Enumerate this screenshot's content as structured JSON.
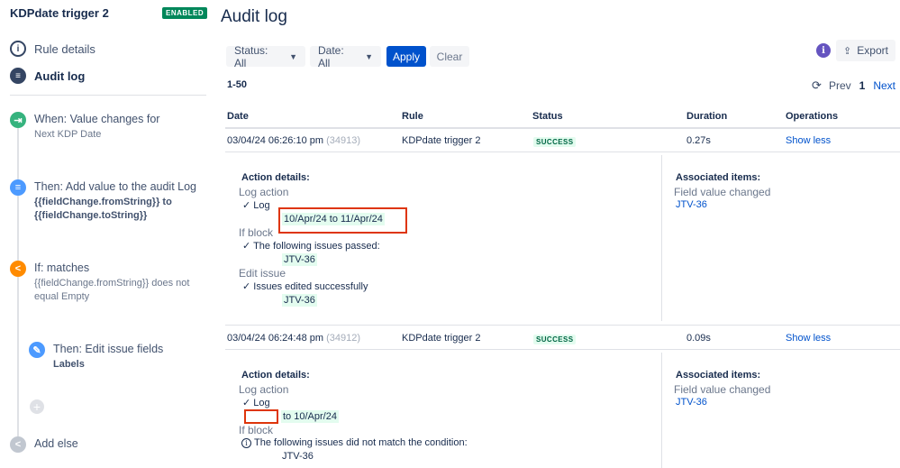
{
  "sidebar": {
    "rule_title": "KDPdate trigger 2",
    "enabled_badge": "ENABLED",
    "nav": [
      {
        "label": "Rule details",
        "icon": "info-icon"
      },
      {
        "label": "Audit log",
        "icon": "list-icon",
        "active": true
      }
    ],
    "steps": [
      {
        "title": "When: Value changes for",
        "sub": "Next KDP Date",
        "icon": "trigger-icon",
        "color": "#36b37e"
      },
      {
        "title": "Then: Add value to the audit Log",
        "sub1": "{{fieldChange.fromString}} to",
        "sub2": "{{fieldChange.toString}}",
        "icon": "document-icon",
        "color": "#4c9aff"
      },
      {
        "title": "If: matches",
        "sub1": "{{fieldChange.fromString}} does not",
        "sub2": "equal Empty",
        "icon": "branch-icon",
        "color": "#ff8b00"
      },
      {
        "title": "Then: Edit issue fields",
        "sub": "Labels",
        "icon": "pencil-icon",
        "color": "#4c9aff"
      },
      {
        "title": "Add else",
        "icon": "branch-icon",
        "color": "#c1c7d0"
      }
    ]
  },
  "main": {
    "title": "Audit log",
    "filters": {
      "status": "Status: All",
      "date": "Date: All",
      "apply": "Apply",
      "clear": "Clear"
    },
    "export": "Export",
    "range": "1-50",
    "pager": {
      "prev": "Prev",
      "current": "1",
      "next": "Next"
    },
    "columns": [
      "Date",
      "Rule",
      "Status",
      "Duration",
      "Operations"
    ],
    "rows": [
      {
        "date": "03/04/24 06:26:10 pm",
        "id": "(34913)",
        "rule": "KDPdate trigger 2",
        "status": "SUCCESS",
        "duration": "0.27s",
        "operation": "Show less",
        "details": {
          "heading": "Action details:",
          "log_section": "Log action",
          "log_label": "✓ Log",
          "log_value": "10/Apr/24 to 11/Apr/24",
          "if_section": "If block",
          "if_line": "✓ The following issues passed:",
          "if_issue": "JTV-36",
          "edit_section": "Edit issue",
          "edit_line": "✓ Issues edited successfully",
          "edit_issue": "JTV-36",
          "assoc_heading": "Associated items:",
          "assoc_label": "Field value changed",
          "assoc_issue": "JTV-36"
        }
      },
      {
        "date": "03/04/24 06:24:48 pm",
        "id": "(34912)",
        "rule": "KDPdate trigger 2",
        "status": "SUCCESS",
        "duration": "0.09s",
        "operation": "Show less",
        "details": {
          "heading": "Action details:",
          "log_section": "Log action",
          "log_label": "✓ Log",
          "log_value": "to 10/Apr/24",
          "if_section": "If block",
          "if_line": "The following issues did not match the condition:",
          "if_issue": "JTV-36",
          "assoc_heading": "Associated items:",
          "assoc_label": "Field value changed",
          "assoc_issue": "JTV-36"
        }
      }
    ]
  }
}
